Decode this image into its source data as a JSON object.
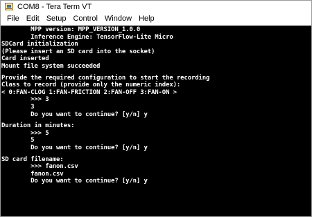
{
  "window": {
    "title": "COM8 - Tera Term VT"
  },
  "menu": [
    "File",
    "Edit",
    "Setup",
    "Control",
    "Window",
    "Help"
  ],
  "terminal": {
    "lines": [
      "        MPP version: MPP_VERSION_1.0.0",
      "        Inference Engine: TensorFlow-Lite Micro",
      "SDCard initialization",
      "(Please insert an SD card into the socket)",
      "Card inserted",
      "Mount file system succeeded",
      "",
      "Provide the required configuration to start the recording",
      "Class to record (provide only the numeric index):",
      "< 0:FAN-CLOG 1:FAN-FRICTION 2:FAN-OFF 3:FAN-ON >",
      "        >>> 3",
      "        3",
      "        Do you want to continue? [y/n] y",
      "",
      "Duration in minutes:",
      "        >>> 5",
      "        5",
      "        Do you want to continue? [y/n] y",
      "",
      "SD card filename:",
      "        >>> fanon.csv",
      "        fanon.csv",
      "        Do you want to continue? [y/n] y"
    ]
  }
}
